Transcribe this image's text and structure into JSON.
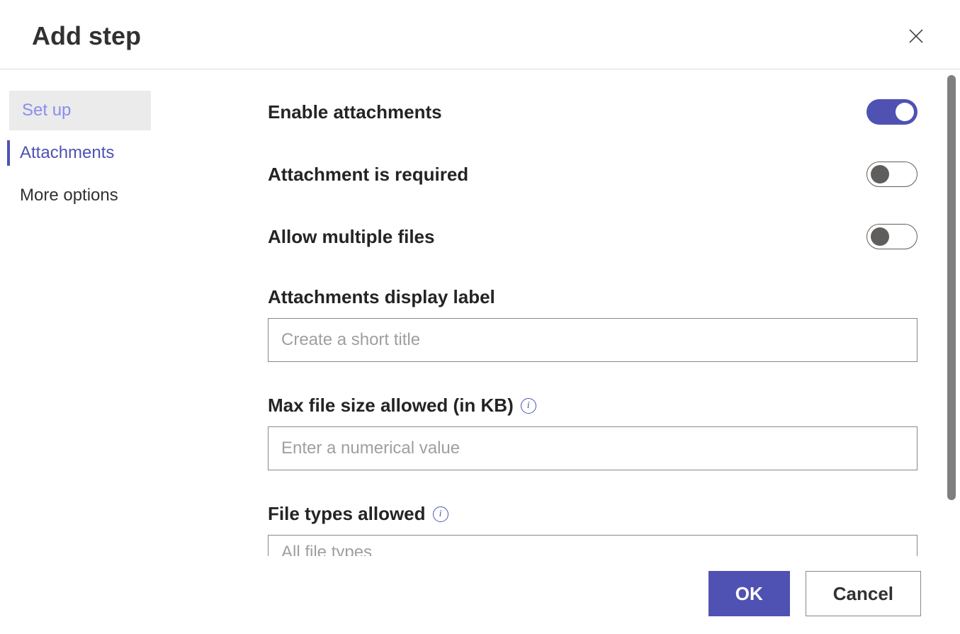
{
  "header": {
    "title": "Add step"
  },
  "sidebar": {
    "items": [
      {
        "label": "Set up"
      },
      {
        "label": "Attachments"
      },
      {
        "label": "More options"
      }
    ]
  },
  "main": {
    "enable_attachments_label": "Enable attachments",
    "attachment_required_label": "Attachment is required",
    "allow_multiple_label": "Allow multiple files",
    "display_label": "Attachments display label",
    "display_placeholder": "Create a short title",
    "display_value": "",
    "max_size_label": "Max file size allowed (in KB)",
    "max_size_placeholder": "Enter a numerical value",
    "max_size_value": "",
    "file_types_label": "File types allowed",
    "file_types_value": "All file types",
    "toggles": {
      "enable_attachments": true,
      "attachment_required": false,
      "allow_multiple": false
    }
  },
  "footer": {
    "ok_label": "OK",
    "cancel_label": "Cancel"
  }
}
